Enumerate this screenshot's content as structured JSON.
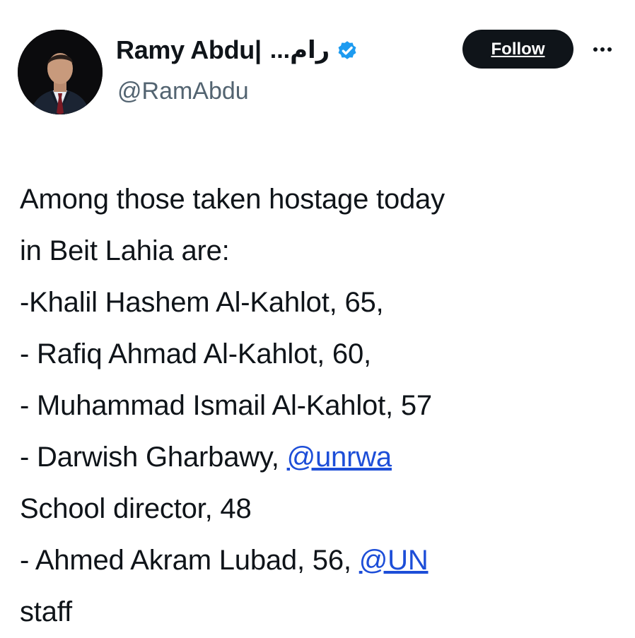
{
  "author": {
    "display_name_latin": "Ramy Abdu|",
    "display_name_arabic": "رام...",
    "handle": "@RamAbdu",
    "verified": true,
    "verified_color": "#1d9bf0"
  },
  "actions": {
    "follow_label": "Follow",
    "more_label": "···"
  },
  "tweet": {
    "lines": [
      {
        "text": "Among those taken hostage today"
      },
      {
        "text": "in Beit Lahia are:"
      },
      {
        "text": "-Khalil Hashem Al-Kahlot, 65,"
      },
      {
        "text": "- Rafiq Ahmad Al-Kahlot, 60,"
      },
      {
        "text": "- Muhammad Ismail Al-Kahlot, 57"
      },
      {
        "text": "- Darwish Gharbawy, ",
        "mention": "@unrwa"
      },
      {
        "text": "School director, 48"
      },
      {
        "text": "- Ahmed Akram Lubad, 56, ",
        "mention": "@UN"
      },
      {
        "text": "staff"
      }
    ]
  },
  "colors": {
    "text": "#0f1419",
    "secondary": "#536471",
    "mention": "#1d4ed8",
    "follow_bg": "#0f1419"
  }
}
